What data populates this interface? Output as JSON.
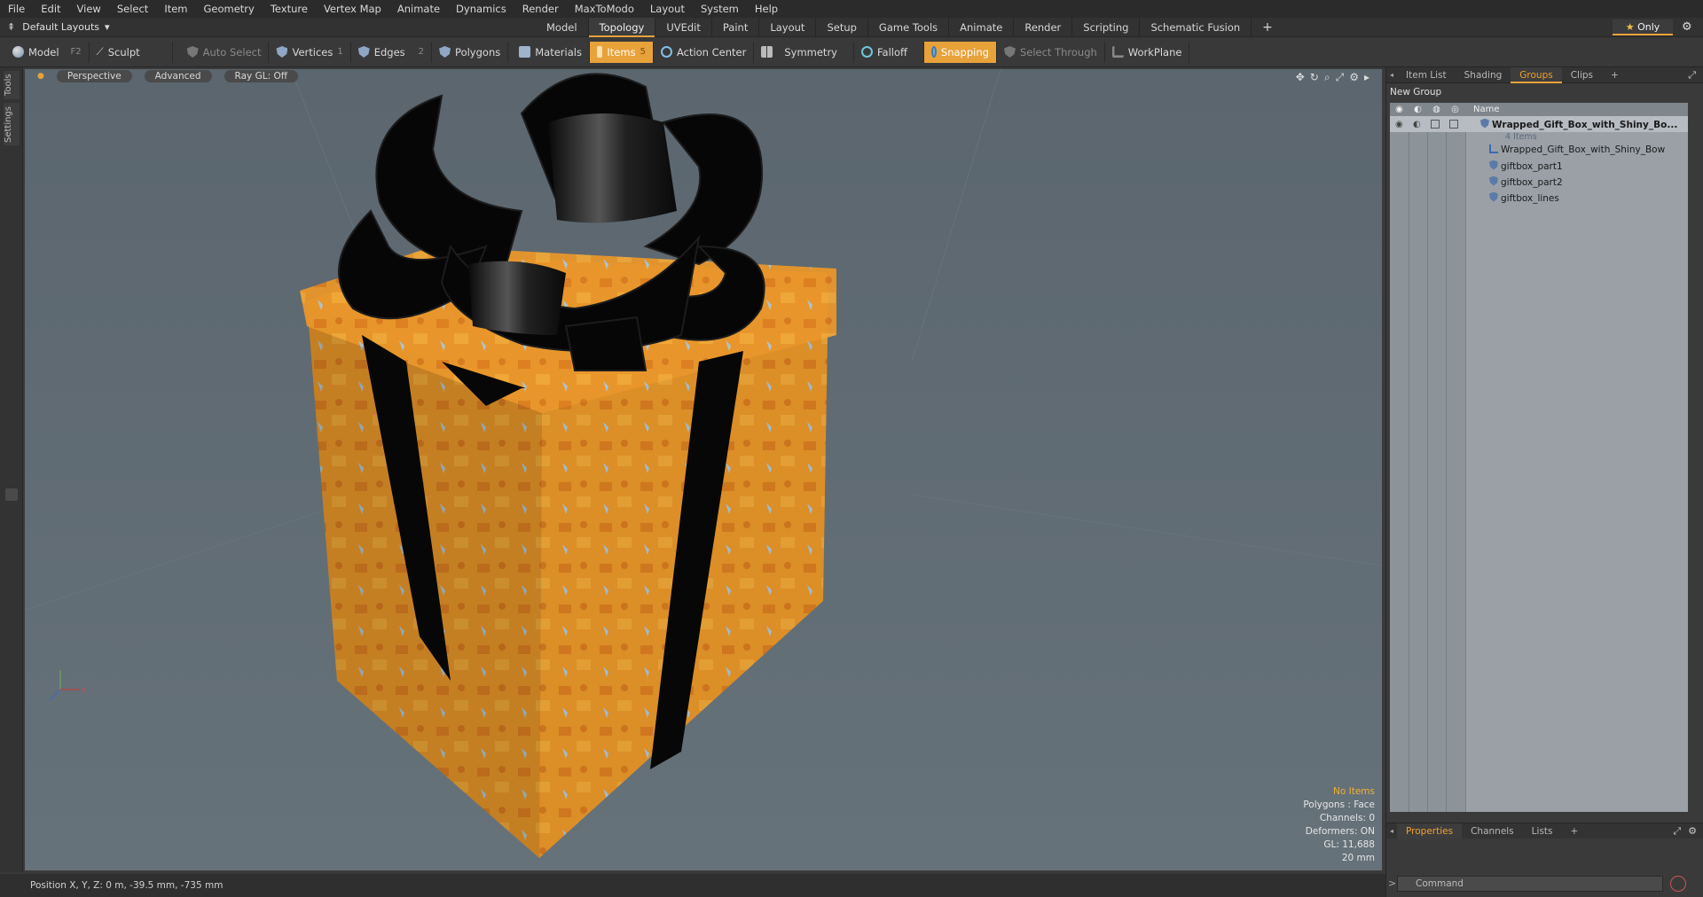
{
  "menu": [
    "File",
    "Edit",
    "View",
    "Select",
    "Item",
    "Geometry",
    "Texture",
    "Vertex Map",
    "Animate",
    "Dynamics",
    "Render",
    "MaxToModo",
    "Layout",
    "System",
    "Help"
  ],
  "layout_selector": "Default Layouts",
  "layout_tabs": [
    {
      "label": "Model",
      "active": false
    },
    {
      "label": "Topology",
      "active": true
    },
    {
      "label": "UVEdit",
      "active": false
    },
    {
      "label": "Paint",
      "active": false
    },
    {
      "label": "Layout",
      "active": false
    },
    {
      "label": "Setup",
      "active": false
    },
    {
      "label": "Game Tools",
      "active": false
    },
    {
      "label": "Animate",
      "active": false
    },
    {
      "label": "Render",
      "active": false
    },
    {
      "label": "Scripting",
      "active": false
    },
    {
      "label": "Schematic Fusion",
      "active": false
    }
  ],
  "add_tab": "+",
  "only_button": "Only",
  "toolbar": {
    "model": "Model",
    "model_key": "F2",
    "sculpt": "Sculpt",
    "auto_select": "Auto Select",
    "vertices": "Vertices",
    "vertices_num": "1",
    "edges": "Edges",
    "edges_num": "2",
    "polygons": "Polygons",
    "materials": "Materials",
    "items": "Items",
    "items_num": "5",
    "action_center": "Action Center",
    "symmetry": "Symmetry",
    "falloff": "Falloff",
    "snapping": "Snapping",
    "select_through": "Select Through",
    "workplane": "WorkPlane"
  },
  "side_tabs": [
    "Tools",
    "Settings"
  ],
  "viewport": {
    "view_mode": "Perspective",
    "shading": "Advanced",
    "raygl": "Ray GL: Off",
    "info": {
      "no_items": "No Items",
      "polygons": "Polygons : Face",
      "channels": "Channels: 0",
      "deformers": "Deformers: ON",
      "gl": "GL: 11,688",
      "scale": "20 mm"
    }
  },
  "status": "Position X, Y, Z:  0 m, -39.5 mm, -735 mm",
  "right_panel": {
    "tabs": [
      {
        "label": "Item List",
        "active": false
      },
      {
        "label": "Shading",
        "active": false
      },
      {
        "label": "Groups",
        "active": true
      },
      {
        "label": "Clips",
        "active": false
      },
      {
        "label": "+",
        "active": false
      }
    ],
    "new_group": "New Group",
    "name_header": "Name",
    "group_name": "Wrapped_Gift_Box_with_Shiny_Bo...",
    "group_count": "4 Items",
    "children": [
      "Wrapped_Gift_Box_with_Shiny_Bow",
      "giftbox_part1",
      "giftbox_part2",
      "giftbox_lines"
    ],
    "bottom_tabs": [
      {
        "label": "Properties",
        "active": true
      },
      {
        "label": "Channels",
        "active": false
      },
      {
        "label": "Lists",
        "active": false
      },
      {
        "label": "+",
        "active": false
      }
    ],
    "command_placeholder": "Command"
  },
  "colors": {
    "accent": "#e8a23a",
    "viewport_bg": "#5f6b73",
    "box_orange": "#e89a2a",
    "ribbon": "#0a0a0a"
  }
}
